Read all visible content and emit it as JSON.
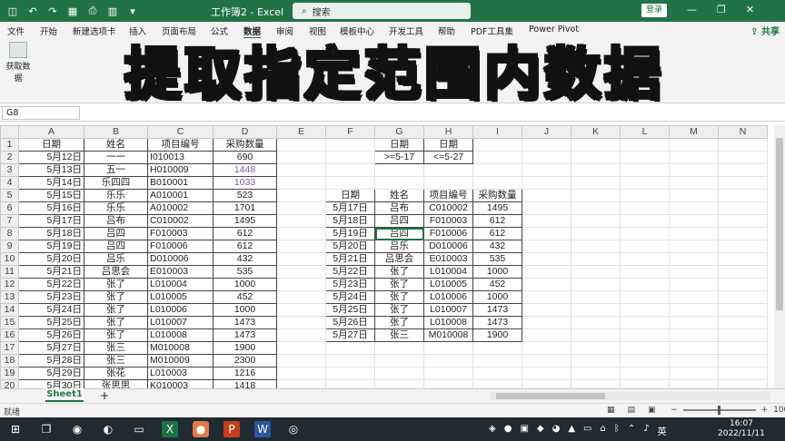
{
  "window": {
    "title": "工作簿2 - Excel",
    "search_placeholder": "搜索",
    "login_label": "登录"
  },
  "menu": {
    "tabs": [
      "文件",
      "开始",
      "新建选项卡",
      "插入",
      "页面布局",
      "公式",
      "数据",
      "审阅",
      "视图",
      "模板中心",
      "开发工具",
      "帮助",
      "PDF工具集",
      "Power Pivot"
    ],
    "active_tab": "数据",
    "share_label": "共享"
  },
  "ribbon": {
    "get_data_label": "获取数据"
  },
  "overlay": {
    "title": "提取指定范围内数据"
  },
  "formula_bar": {
    "name_box": "G8",
    "formula": ""
  },
  "grid": {
    "columns": [
      "A",
      "B",
      "C",
      "D",
      "E",
      "F",
      "G",
      "H",
      "I",
      "J",
      "K",
      "L",
      "M",
      "N"
    ],
    "rows": [
      [
        "日期",
        "姓名",
        "项目编号",
        "采购数量",
        "",
        "",
        "日期",
        "日期",
        "",
        "",
        "",
        "",
        "",
        ""
      ],
      [
        "5月12日",
        "一一",
        "I010013",
        "690",
        "",
        "",
        ">=5-17",
        "<=5-27",
        "",
        "",
        "",
        "",
        "",
        ""
      ],
      [
        "5月13日",
        "五一",
        "H010009",
        "1448",
        "",
        "",
        "",
        "",
        "",
        "",
        "",
        "",
        "",
        ""
      ],
      [
        "5月14日",
        "乐四四",
        "B010001",
        "1033",
        "",
        "",
        "",
        "",
        "",
        "",
        "",
        "",
        "",
        ""
      ],
      [
        "5月15日",
        "乐乐",
        "A010001",
        "523",
        "",
        "日期",
        "姓名",
        "项目编号",
        "采购数量",
        "",
        "",
        "",
        "",
        ""
      ],
      [
        "5月16日",
        "乐乐",
        "A010002",
        "1701",
        "",
        "5月17日",
        "吕布",
        "C010002",
        "1495",
        "",
        "",
        "",
        "",
        ""
      ],
      [
        "5月17日",
        "吕布",
        "C010002",
        "1495",
        "",
        "5月18日",
        "吕四",
        "F010003",
        "612",
        "",
        "",
        "",
        "",
        ""
      ],
      [
        "5月18日",
        "吕四",
        "F010003",
        "612",
        "",
        "5月19日",
        "吕四",
        "F010006",
        "612",
        "",
        "",
        "",
        "",
        ""
      ],
      [
        "5月19日",
        "吕四",
        "F010006",
        "612",
        "",
        "5月20日",
        "吕乐",
        "D010006",
        "432",
        "",
        "",
        "",
        "",
        ""
      ],
      [
        "5月20日",
        "吕乐",
        "D010006",
        "432",
        "",
        "5月21日",
        "吕思会",
        "E010003",
        "535",
        "",
        "",
        "",
        "",
        ""
      ],
      [
        "5月21日",
        "吕思会",
        "E010003",
        "535",
        "",
        "5月22日",
        "张了",
        "L010004",
        "1000",
        "",
        "",
        "",
        "",
        ""
      ],
      [
        "5月22日",
        "张了",
        "L010004",
        "1000",
        "",
        "5月23日",
        "张了",
        "L010005",
        "452",
        "",
        "",
        "",
        "",
        ""
      ],
      [
        "5月23日",
        "张了",
        "L010005",
        "452",
        "",
        "5月24日",
        "张了",
        "L010006",
        "1000",
        "",
        "",
        "",
        "",
        ""
      ],
      [
        "5月24日",
        "张了",
        "L010006",
        "1000",
        "",
        "5月25日",
        "张了",
        "L010007",
        "1473",
        "",
        "",
        "",
        "",
        ""
      ],
      [
        "5月25日",
        "张了",
        "L010007",
        "1473",
        "",
        "5月26日",
        "张了",
        "L010008",
        "1473",
        "",
        "",
        "",
        "",
        ""
      ],
      [
        "5月26日",
        "张了",
        "L010008",
        "1473",
        "",
        "5月27日",
        "张三",
        "M010008",
        "1900",
        "",
        "",
        "",
        "",
        ""
      ],
      [
        "5月27日",
        "张三",
        "M010008",
        "1900",
        "",
        "",
        "",
        "",
        "",
        "",
        "",
        "",
        "",
        ""
      ],
      [
        "5月28日",
        "张三",
        "M010009",
        "2300",
        "",
        "",
        "",
        "",
        "",
        "",
        "",
        "",
        "",
        ""
      ],
      [
        "5月29日",
        "张花",
        "L010003",
        "1216",
        "",
        "",
        "",
        "",
        "",
        "",
        "",
        "",
        "",
        ""
      ],
      [
        "5月30日",
        "张思思",
        "K010003",
        "1418",
        "",
        "",
        "",
        "",
        "",
        "",
        "",
        "",
        "",
        ""
      ]
    ]
  },
  "sheet_tabs": {
    "active": "Sheet1",
    "add_label": "+"
  },
  "status": {
    "ready": "就绪",
    "zoom": "100%"
  },
  "taskbar": {
    "ime": "英",
    "time": "16:07",
    "date": "2022/11/11"
  },
  "colors": {
    "excel_green": "#217346",
    "overlay_yellow": "#ffe600",
    "value_purple": "#7a5aa8"
  }
}
